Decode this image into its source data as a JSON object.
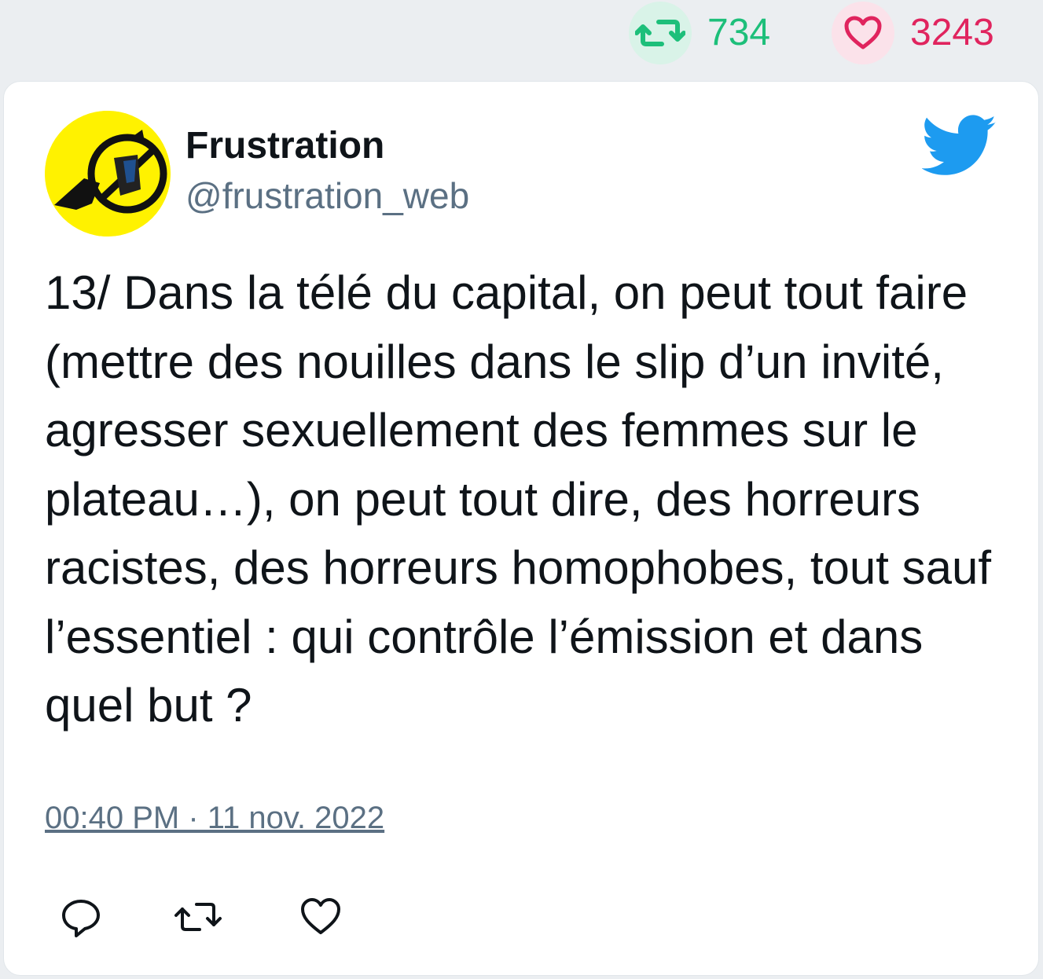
{
  "stats": {
    "retweets": "734",
    "likes": "3243",
    "retweet_color": "#1dbf7a",
    "like_color": "#e0245e"
  },
  "tweet": {
    "author_name": "Frustration",
    "author_handle": "@frustration_web",
    "text": "13/ Dans la télé du capital, on peut tout faire (mettre des nouilles dans le slip d’un invité, agresser sexuellement des femmes sur le plateau…), on peut tout dire, des horreurs racistes, des horreurs homophobes, tout sauf l’essentiel : qui contrôle l’émission et dans quel but ?",
    "timestamp": "00:40 PM · 11 nov. 2022"
  },
  "icons": {
    "brand": "twitter-bird-icon",
    "actions": [
      "reply-icon",
      "retweet-icon",
      "heart-icon"
    ]
  },
  "colors": {
    "twitter_blue": "#1d9bf0",
    "avatar_bg": "#fff200"
  }
}
